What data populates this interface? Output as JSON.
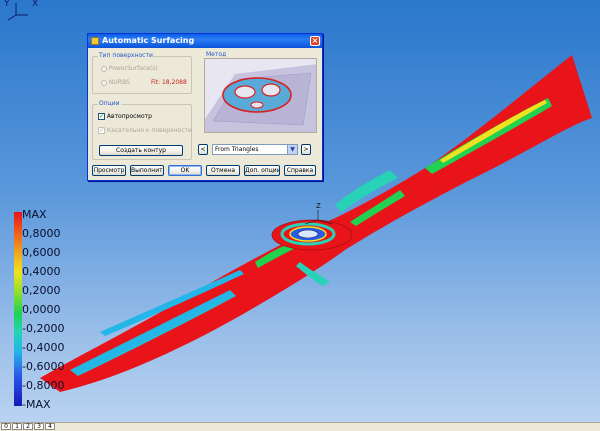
{
  "viewport": {
    "triad": {
      "y_label": "Y",
      "x_label": "X"
    },
    "model_axis_label": "Z"
  },
  "legend": {
    "labels": [
      "MAX",
      "0,8000",
      "0,6000",
      "0,4000",
      "0,2000",
      "0,0000",
      "-0,2000",
      "-0,4000",
      "-0,6000",
      "-0,8000",
      "-MAX"
    ],
    "colors": [
      "#e8141a",
      "#ef5a18",
      "#f2a51d",
      "#f1e21f",
      "#93e02c",
      "#20d24f",
      "#27d2b6",
      "#23b6e8",
      "#2a5be8",
      "#1818b8"
    ]
  },
  "dialog": {
    "title": "Automatic Surfacing",
    "close_icon": "close-icon",
    "surface_type_group": "Тип поверхности",
    "radio_powersurface": "PowerSurface(s)",
    "radio_nurbs": "NURBS",
    "fit_label": "Fit: 18,2088",
    "options_group": "Опции",
    "chk_autopreview": "Автопросмотр",
    "chk_tangent": "Касательно к поверхности",
    "btn_create_contour": "Создать контур",
    "method_group": "Метод",
    "nav_prev": "<",
    "nav_next": ">",
    "method_value": "From Triangles",
    "buttons": {
      "preview": "Просмотр",
      "execute": "Выполнить",
      "ok": "OK",
      "cancel": "Отмена",
      "more_options": "Доп. опции",
      "help": "Справка"
    }
  },
  "tabs": [
    "0",
    "1",
    "2",
    "3",
    "4"
  ],
  "colors": {
    "accent": "#0a5fe8",
    "fit_red": "#c8201c",
    "surface_red": "#e8141a"
  }
}
